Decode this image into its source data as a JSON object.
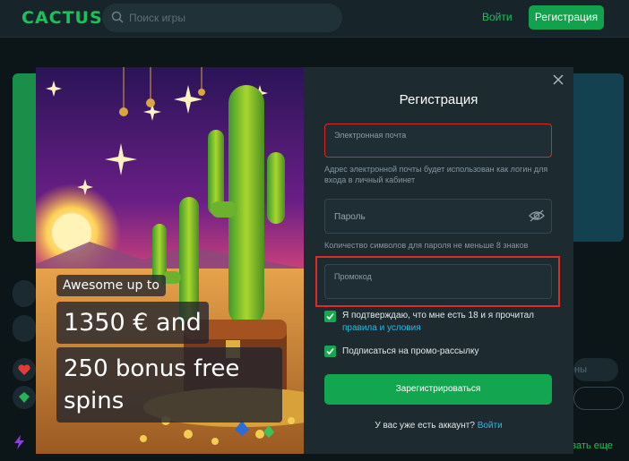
{
  "header": {
    "logo": "CACTUS",
    "search_placeholder": "Поиск игры",
    "login_label": "Войти",
    "register_label": "Регистрация"
  },
  "background": {
    "chip_text": "ны",
    "link_text": "азать еще"
  },
  "promo": {
    "line1": "Awesome up to",
    "line2": "1350 € and",
    "line3": "250 bonus free spins"
  },
  "form": {
    "title": "Регистрация",
    "email_label": "Электронная почта",
    "email_hint": "Адрес электронной почты будет использован как логин для входа в личный кабинет",
    "password_label": "Пароль",
    "password_hint": "Количество символов для пароля не меньше 8 знаков",
    "promo_label": "Промокод",
    "age_confirm": "Я подтверждаю, что мне есть 18 и я прочитал",
    "terms_link": "правила и условия",
    "newsletter": "Подписаться на промо-рассылку",
    "submit": "Зарегистрироваться",
    "have_account": "У вас уже есть аккаунт?",
    "login_link": "Войти",
    "age_checked": true,
    "newsletter_checked": true
  },
  "colors": {
    "brand_green": "#12a14c",
    "link_blue": "#2fb7e0",
    "highlight_red": "#e02b25"
  }
}
